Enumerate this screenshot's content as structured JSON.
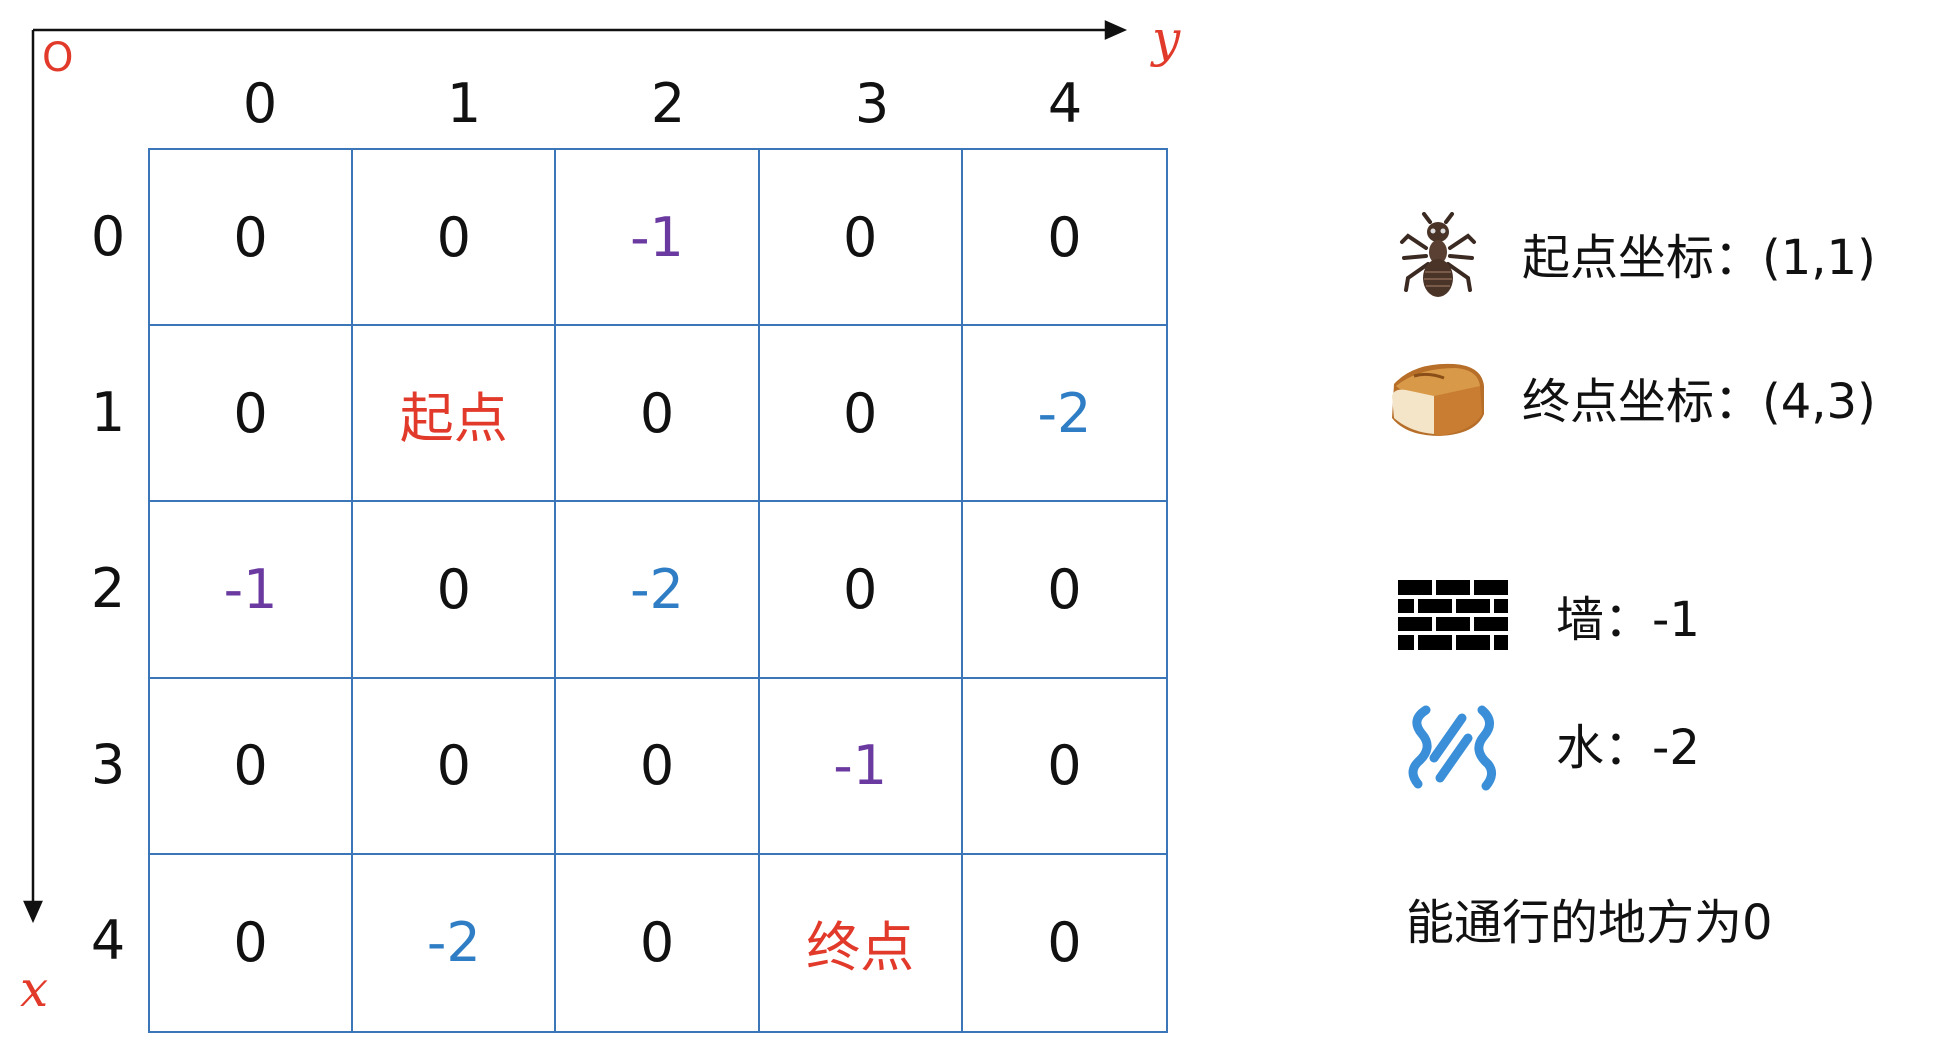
{
  "axes": {
    "origin_label": "O",
    "x_label": "x",
    "y_label": "y",
    "column_headers": [
      "0",
      "1",
      "2",
      "3",
      "4"
    ],
    "row_headers": [
      "0",
      "1",
      "2",
      "3",
      "4"
    ]
  },
  "grid": {
    "rows": [
      [
        {
          "text": "0",
          "kind": "0"
        },
        {
          "text": "0",
          "kind": "0"
        },
        {
          "text": "-1",
          "kind": "wall"
        },
        {
          "text": "0",
          "kind": "0"
        },
        {
          "text": "0",
          "kind": "0"
        }
      ],
      [
        {
          "text": "0",
          "kind": "0"
        },
        {
          "text": "起点",
          "kind": "start"
        },
        {
          "text": "0",
          "kind": "0"
        },
        {
          "text": "0",
          "kind": "0"
        },
        {
          "text": "-2",
          "kind": "water"
        }
      ],
      [
        {
          "text": "-1",
          "kind": "wall"
        },
        {
          "text": "0",
          "kind": "0"
        },
        {
          "text": "-2",
          "kind": "water"
        },
        {
          "text": "0",
          "kind": "0"
        },
        {
          "text": "0",
          "kind": "0"
        }
      ],
      [
        {
          "text": "0",
          "kind": "0"
        },
        {
          "text": "0",
          "kind": "0"
        },
        {
          "text": "0",
          "kind": "0"
        },
        {
          "text": "-1",
          "kind": "wall"
        },
        {
          "text": "0",
          "kind": "0"
        }
      ],
      [
        {
          "text": "0",
          "kind": "0"
        },
        {
          "text": "-2",
          "kind": "water"
        },
        {
          "text": "0",
          "kind": "0"
        },
        {
          "text": "终点",
          "kind": "end"
        },
        {
          "text": "0",
          "kind": "0"
        }
      ]
    ]
  },
  "legend": {
    "start": {
      "icon": "ant-icon",
      "text": "起点坐标：(1,1)"
    },
    "end": {
      "icon": "bread-icon",
      "text": "终点坐标：(4,3)"
    },
    "wall": {
      "icon": "brick-wall-icon",
      "text": "墙：-1"
    },
    "water": {
      "icon": "water-icon",
      "text": "水：-2"
    },
    "passable_note": "能通行的地方为0"
  },
  "colors": {
    "grid_line": "#3a76b8",
    "axis_label": "#e23a2a",
    "wall_value": "#6a3aa0",
    "water_value": "#2f7ec5",
    "start_end_text": "#e23a2a"
  }
}
